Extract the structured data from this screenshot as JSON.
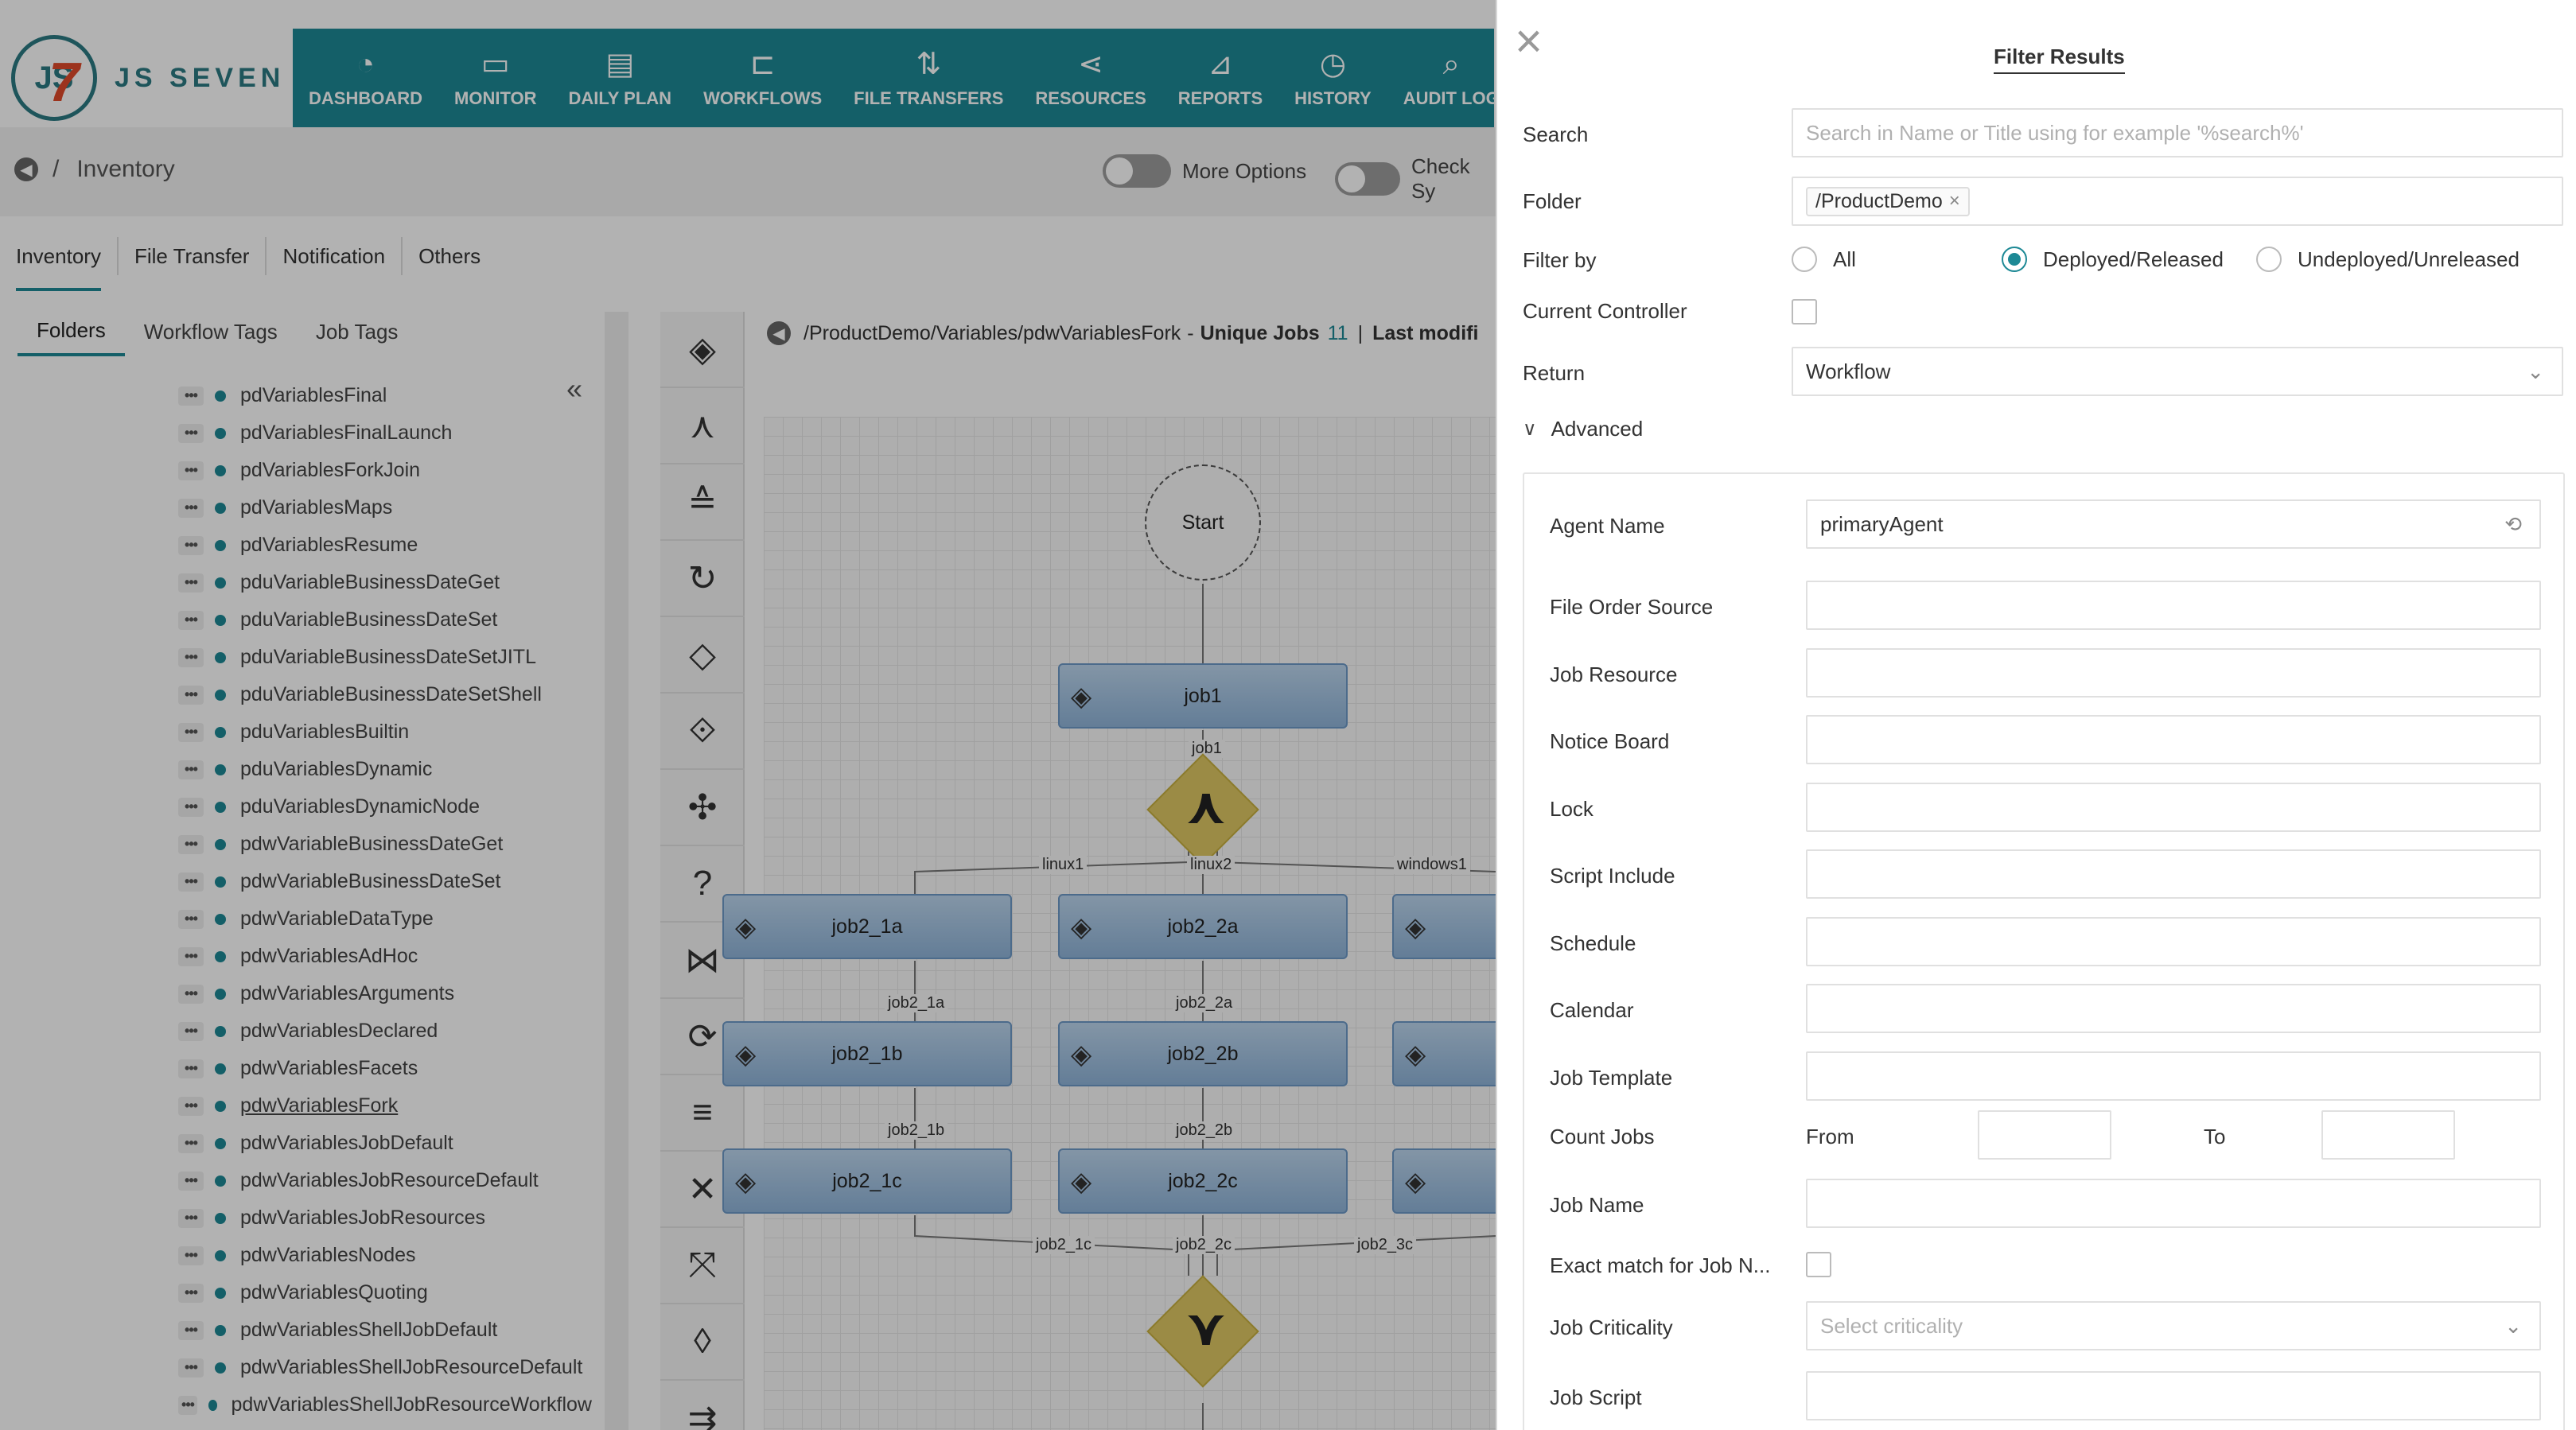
{
  "app": {
    "logo_text": "JS SEVEN",
    "logo_badge": "JS",
    "logo_seven": "7"
  },
  "nav": {
    "items": [
      {
        "label": "DASHBOARD",
        "icon": "speedometer-icon"
      },
      {
        "label": "MONITOR",
        "icon": "monitor-icon"
      },
      {
        "label": "DAILY PLAN",
        "icon": "calendar-icon"
      },
      {
        "label": "WORKFLOWS",
        "icon": "workflow-icon"
      },
      {
        "label": "FILE TRANSFERS",
        "icon": "transfer-icon"
      },
      {
        "label": "RESOURCES",
        "icon": "share-icon"
      },
      {
        "label": "REPORTS",
        "icon": "chart-icon"
      },
      {
        "label": "HISTORY",
        "icon": "clock-icon"
      },
      {
        "label": "AUDIT LOG",
        "icon": "search-doc-icon"
      }
    ]
  },
  "breadcrumb": {
    "sep": "/",
    "page": "Inventory"
  },
  "toggles": {
    "more_options": "More Options",
    "check_sync": "Check Sy"
  },
  "tabs": [
    "Inventory",
    "File Transfer",
    "Notification",
    "Others"
  ],
  "subtabs": [
    "Folders",
    "Workflow Tags",
    "Job Tags"
  ],
  "tree": {
    "collapse": "«",
    "dots": "•••",
    "items": [
      "pdVariablesFinal",
      "pdVariablesFinalLaunch",
      "pdVariablesForkJoin",
      "pdVariablesMaps",
      "pdVariablesResume",
      "pduVariableBusinessDateGet",
      "pduVariableBusinessDateSet",
      "pduVariableBusinessDateSetJITL",
      "pduVariableBusinessDateSetShell",
      "pduVariablesBuiltin",
      "pduVariablesDynamic",
      "pduVariablesDynamicNode",
      "pdwVariableBusinessDateGet",
      "pdwVariableBusinessDateSet",
      "pdwVariableDataType",
      "pdwVariablesAdHoc",
      "pdwVariablesArguments",
      "pdwVariablesDeclared",
      "pdwVariablesFacets",
      "pdwVariablesFork",
      "pdwVariablesJobDefault",
      "pdwVariablesJobResourceDefault",
      "pdwVariablesJobResources",
      "pdwVariablesNodes",
      "pdwVariablesQuoting",
      "pdwVariablesShellJobDefault",
      "pdwVariablesShellJobResourceDefault",
      "pdwVariablesShellJobResourceWorkflow"
    ],
    "selected": "pdwVariablesFork"
  },
  "canvas": {
    "path": "/ProductDemo/Variables/pdwVariablesFork",
    "dash": "-",
    "unique_jobs_label": "Unique Jobs",
    "unique_jobs_count": "11",
    "pipe": "|",
    "last_modified_label": "Last modifi",
    "start_label": "Start",
    "jobs": [
      "job1",
      "job2_1a",
      "job2_2a",
      "job2_1b",
      "job2_2b",
      "job2_1c",
      "job2_2c"
    ],
    "edge_labels": [
      "job1",
      "linux1",
      "linux2",
      "windows1",
      "job2_1a",
      "job2_2a",
      "job2_1b",
      "job2_2b",
      "job2_1c",
      "job2_2c",
      "job2_3c"
    ],
    "collapse_marker": "⊟"
  },
  "filter": {
    "title": "Filter Results",
    "close": "×",
    "search_label": "Search",
    "search_placeholder": "Search in Name or Title using for example '%search%'",
    "folder_label": "Folder",
    "folder_chip": "/ProductDemo",
    "chip_x": "×",
    "filter_by_label": "Filter by",
    "filter_by_options": [
      "All",
      "Deployed/Released",
      "Undeployed/Unreleased"
    ],
    "filter_by_selected": "Deployed/Released",
    "current_controller_label": "Current Controller",
    "current_controller_checked": false,
    "return_label": "Return",
    "return_value": "Workflow",
    "advanced_label": "Advanced",
    "agent_name_label": "Agent Name",
    "agent_name_value": "primaryAgent",
    "fields": [
      "File Order Source",
      "Job Resource",
      "Notice Board",
      "Lock",
      "Script Include",
      "Schedule",
      "Calendar",
      "Job Template"
    ],
    "count_jobs_label": "Count Jobs",
    "from_label": "From",
    "to_label": "To",
    "job_name_label": "Job Name",
    "exact_match_label": "Exact match for Job N...",
    "exact_match_checked": false,
    "job_criticality_label": "Job Criticality",
    "job_criticality_placeholder": "Select criticality",
    "job_script_label": "Job Script"
  },
  "colors": {
    "brand": "#1d8995",
    "logo_accent": "#e04a2a",
    "job_fill": "#a9c8e6",
    "diamond": "#dfc864"
  }
}
